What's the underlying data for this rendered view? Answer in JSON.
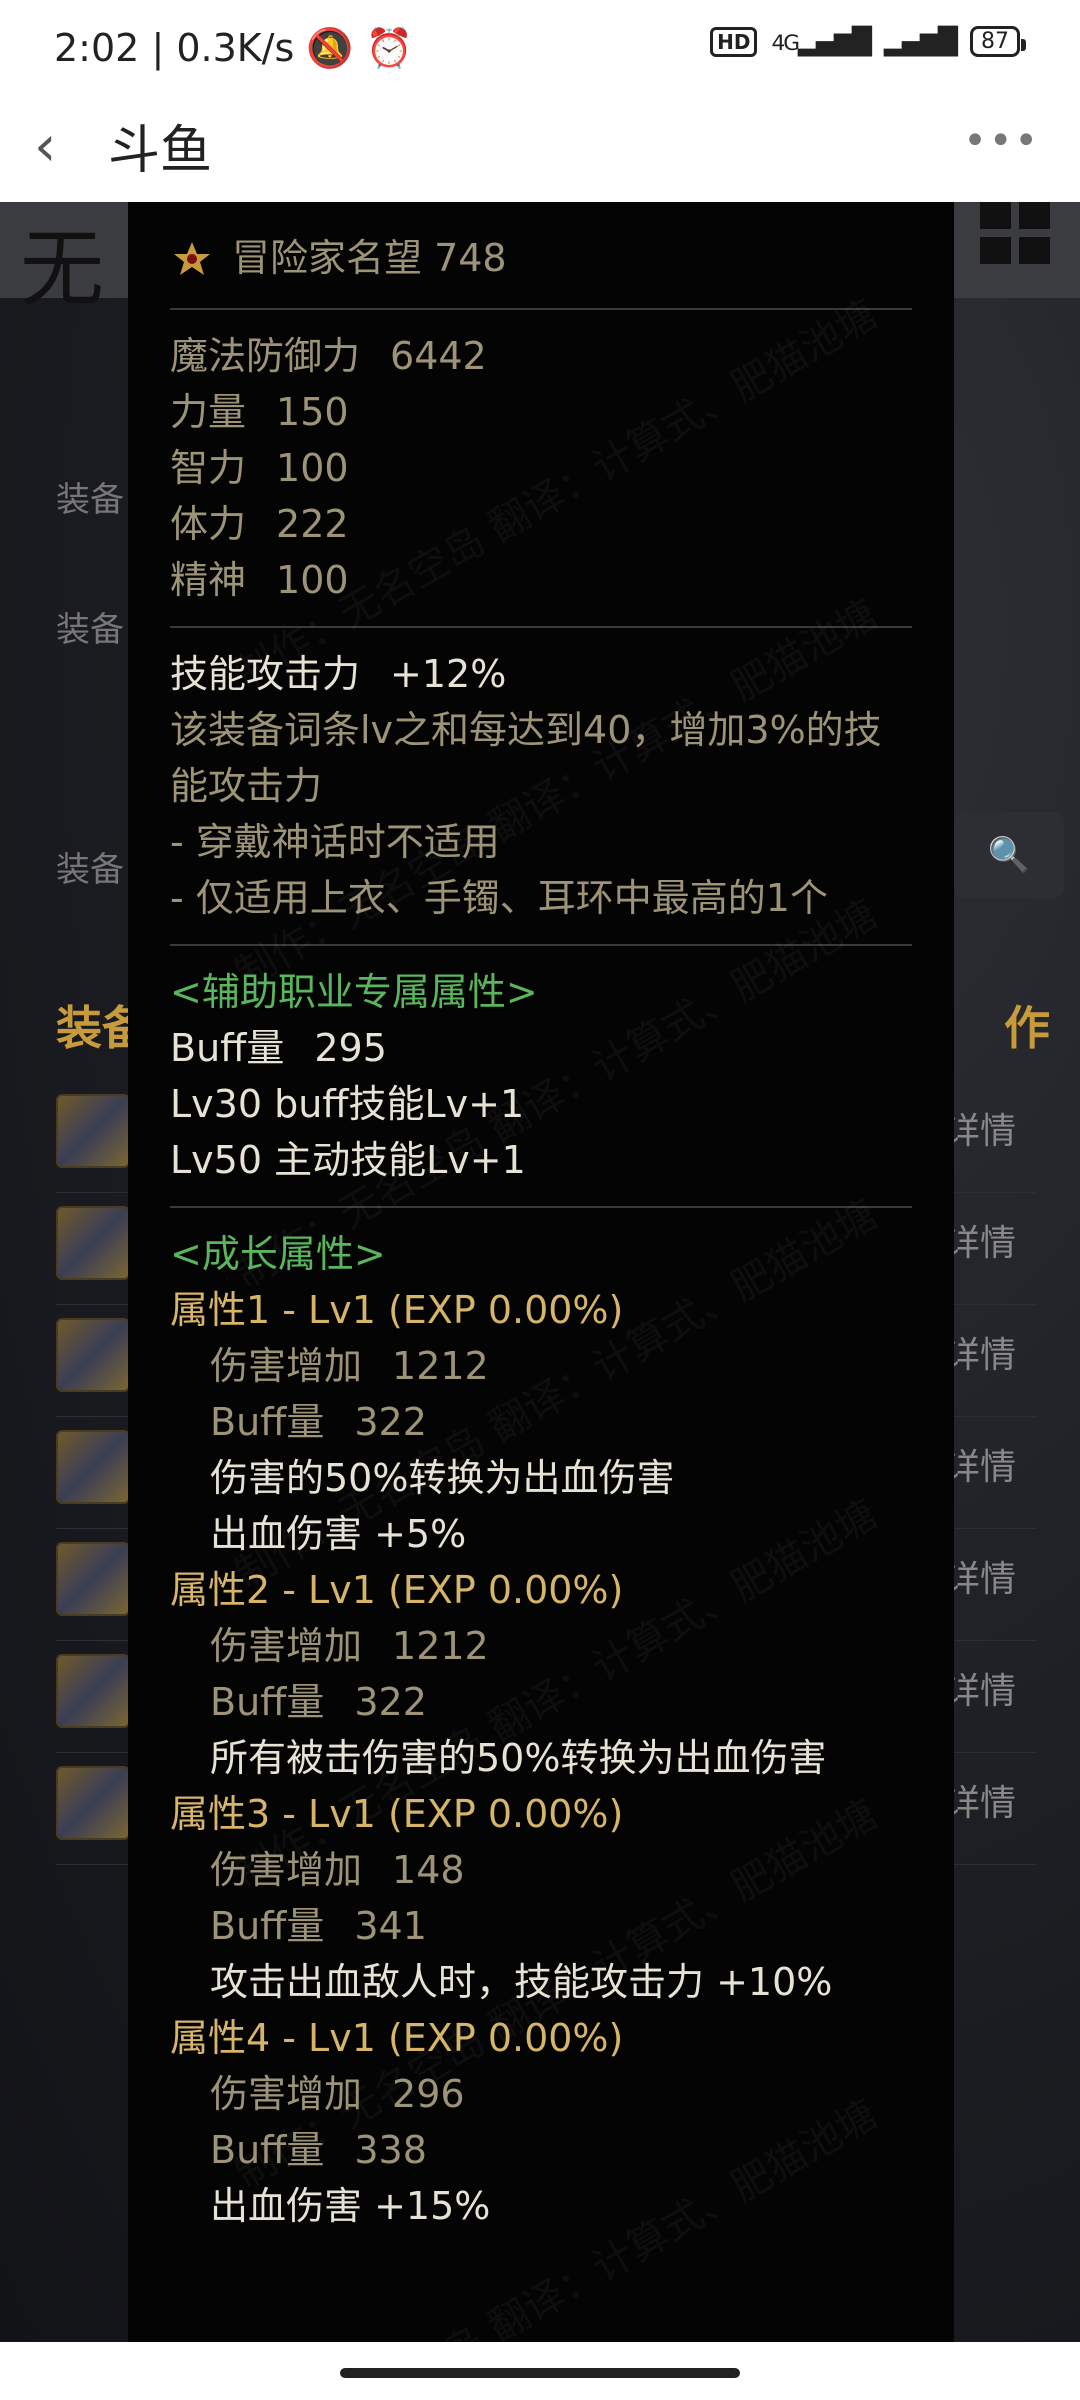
{
  "status": {
    "time": "2:02",
    "speed": "0.3K/s",
    "network": "4G",
    "battery": "87"
  },
  "app": {
    "title": "斗鱼"
  },
  "background": {
    "labels": [
      "装备",
      "装备",
      "装备"
    ],
    "heading_left": "装备",
    "heading_right": "作",
    "row_detail": "详情"
  },
  "tooltip": {
    "reputation": "冒险家名望 748",
    "basic_stats": [
      {
        "label": "魔法防御力",
        "value": "6442"
      },
      {
        "label": "力量",
        "value": "150"
      },
      {
        "label": "智力",
        "value": "100"
      },
      {
        "label": "体力",
        "value": "222"
      },
      {
        "label": "精神",
        "value": "100"
      }
    ],
    "skill": {
      "title": "技能攻击力",
      "value": "+12%",
      "desc1": "该装备词条lv之和每达到40，增加3%的技",
      "desc2": "能攻击力",
      "note1": "- 穿戴神话时不适用",
      "note2": "- 仅适用上衣、手镯、耳环中最高的1个"
    },
    "support": {
      "header": "<辅助职业专属属性>",
      "buff_label": "Buff量",
      "buff_value": "295",
      "line1": "Lv30 buff技能Lv+1",
      "line2": "Lv50 主动技能Lv+1"
    },
    "growth": {
      "header": "<成长属性>",
      "attrs": [
        {
          "title": "属性1 - Lv1 (EXP 0.00%)",
          "dmg_label": "伤害增加",
          "dmg": "1212",
          "buff_label": "Buff量",
          "buff": "322",
          "effects": [
            "伤害的50%转换为出血伤害",
            "出血伤害 +5%"
          ]
        },
        {
          "title": "属性2 - Lv1 (EXP 0.00%)",
          "dmg_label": "伤害增加",
          "dmg": "1212",
          "buff_label": "Buff量",
          "buff": "322",
          "effects": [
            "所有被击伤害的50%转换为出血伤害"
          ]
        },
        {
          "title": "属性3 - Lv1 (EXP 0.00%)",
          "dmg_label": "伤害增加",
          "dmg": "148",
          "buff_label": "Buff量",
          "buff": "341",
          "effects": [
            "攻击出血敌人时，技能攻击力 +10%"
          ]
        },
        {
          "title": "属性4 - Lv1 (EXP 0.00%)",
          "dmg_label": "伤害增加",
          "dmg": "296",
          "buff_label": "Buff量",
          "buff": "338",
          "effects": [
            "出血伤害 +15%"
          ]
        }
      ]
    },
    "watermark": "制作：无名空岛 翻译：计算式、肥猫池塘"
  },
  "colors": {
    "gold": "#d6b46a",
    "green": "#5ab65d",
    "muted": "#9d9377",
    "panel_bg": "#040404"
  }
}
